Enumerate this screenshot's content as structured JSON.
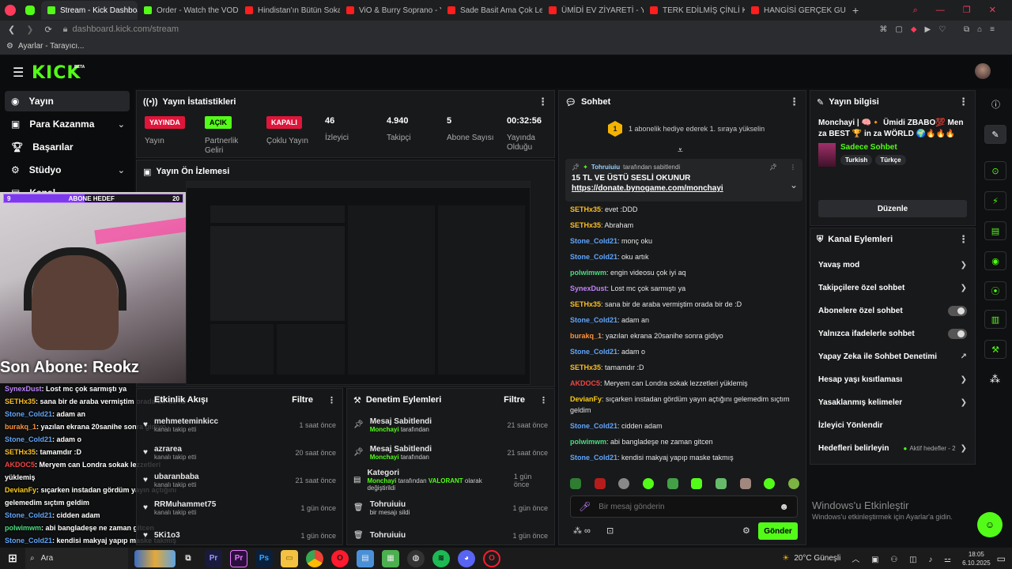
{
  "browser": {
    "tabs": [
      {
        "label": "Stream - Kick Dashboard",
        "kind": "kick",
        "active": true
      },
      {
        "label": "Order - Watch the VOD o",
        "kind": "kick"
      },
      {
        "label": "Hindistan'ın Bütün Sokak",
        "kind": "yt"
      },
      {
        "label": "ViO & Burry Soprano - Yo",
        "kind": "yt"
      },
      {
        "label": "Sade Basit Ama Çok Lezz",
        "kind": "yt"
      },
      {
        "label": "ÜMİDİ EV ZİYARETİ - You",
        "kind": "yt"
      },
      {
        "label": "TERK EDİLMİŞ ÇİNLİ KÖY",
        "kind": "yt"
      },
      {
        "label": "HANGİSİ GERÇEK GURBE",
        "kind": "yt"
      }
    ],
    "url": "dashboard.kick.com/stream",
    "bookmark": "Ayarlar - Tarayıcı..."
  },
  "kick": {
    "logo": "KICK",
    "logo_sup": "BETA"
  },
  "sidebar": {
    "items": [
      {
        "label": "Yayın",
        "active": true,
        "icon": "broadcast-icon",
        "chev": false
      },
      {
        "label": "Para Kazanma",
        "icon": "money-icon",
        "chev": true
      },
      {
        "label": "Başarılar",
        "icon": "trophy-icon",
        "chev": false
      },
      {
        "label": "Stüdyo",
        "icon": "studio-icon",
        "chev": true
      },
      {
        "label": "Kanal",
        "icon": "channel-icon",
        "chev": true
      }
    ]
  },
  "stats": {
    "title": "Yayın İstatistikleri",
    "items": [
      {
        "badge": "YAYINDA",
        "badge_color": "#e0153a",
        "label": "Yayın"
      },
      {
        "badge": "AÇIK",
        "badge_color": "#53fc18",
        "label": "Partnerlik Geliri"
      },
      {
        "badge": "KAPALI",
        "badge_color": "#e0153a",
        "label": "Çoklu Yayın"
      },
      {
        "value": "46",
        "label": "İzleyici"
      },
      {
        "value": "4.940",
        "label": "Takipçi"
      },
      {
        "value": "5",
        "label": "Abone Sayısı"
      },
      {
        "value": "00:32:56",
        "label": "Yayında Olduğu"
      }
    ]
  },
  "preview": {
    "title": "Yayın Ön İzlemesi"
  },
  "overlay": {
    "goal_count": "9",
    "goal_label": "ABONE HEDEF",
    "goal_max": "20",
    "last_sub": "Son Abone: Reokz",
    "chat": [
      {
        "u": "SynexDust",
        "c": "#c084fc",
        "m": "Lost mc çok sarmıştı ya"
      },
      {
        "u": "SETHx35",
        "c": "#fbbf24",
        "m": "sana bir de araba vermiştim orada bir de :D"
      },
      {
        "u": "Stone_Cold21",
        "c": "#60a5fa",
        "m": "adam an"
      },
      {
        "u": "burakq_1",
        "c": "#fb923c",
        "m": "yazılan ekrana 20sanihe sonra gidiyo"
      },
      {
        "u": "Stone_Cold21",
        "c": "#60a5fa",
        "m": "adam o"
      },
      {
        "u": "SETHx35",
        "c": "#fbbf24",
        "m": "tamamdır :D"
      },
      {
        "u": "AKDOC5",
        "c": "#ef4444",
        "m": "Meryem can Londra sokak lezzetleri yüklemiş"
      },
      {
        "u": "DevianFy",
        "c": "#facc15",
        "m": "sıçarken instadan gördüm yayın açtığını gelemedim sıçtım geldim"
      },
      {
        "u": "Stone_Cold21",
        "c": "#60a5fa",
        "m": "cidden adam"
      },
      {
        "u": "polwimwm",
        "c": "#4ade80",
        "m": "abi bangladeşe ne zaman gitcen"
      },
      {
        "u": "Stone_Cold21",
        "c": "#60a5fa",
        "m": "kendisi makyaj yapıp maske takmış"
      }
    ]
  },
  "activity": {
    "title": "Etkinlik Akışı",
    "filter": "Filtre",
    "rows": [
      {
        "name": "mehmeteminkicc",
        "sub": "kanalı takip etti",
        "time": "1 saat önce"
      },
      {
        "name": "azrarea",
        "sub": "kanalı takip etti",
        "time": "20 saat önce"
      },
      {
        "name": "ubaranbaba",
        "sub": "kanalı takip etti",
        "time": "21 saat önce"
      },
      {
        "name": "RRMuhammet75",
        "sub": "kanalı takip etti",
        "time": "1 gün önce"
      },
      {
        "name": "5Ki1o3",
        "sub": "",
        "time": "1 gün önce"
      }
    ]
  },
  "moderation": {
    "title": "Denetim Eylemleri",
    "filter": "Filtre",
    "rows": [
      {
        "title": "Mesaj Sabitlendi",
        "by": "Monchayi",
        "sub": " tarafından",
        "time": "21 saat önce"
      },
      {
        "title": "Mesaj Sabitlendi",
        "by": "Monchayi",
        "sub": " tarafından",
        "time": "21 saat önce"
      },
      {
        "title": "Kategori",
        "by": "Monchayi",
        "sub": " tarafından ",
        "extra": "VALORANT",
        "sub2": " olarak değiştirildi",
        "time": "1 gün önce"
      },
      {
        "title": "Tohruiuiu",
        "by": "",
        "sub": "bir mesajı sildi",
        "time": "1 gün önce"
      },
      {
        "title": "Tohruiuiu",
        "by": "",
        "sub": "",
        "time": "1 gün önce"
      }
    ]
  },
  "chat": {
    "title": "Sohbet",
    "gift_text": "1 abonelik hediye ederek 1. sıraya yükselin",
    "gift_rank": "1",
    "pinned_by": "Tohruiuiu",
    "pinned_by_suffix": " tarafından sabitlendi",
    "pinned_msg": "15 TL VE ÜSTÜ SESLİ OKUNUR",
    "pinned_link": "https://donate.bynogame.com/monchayi",
    "messages": [
      {
        "u": "SETHx35",
        "c": "#fbbf24",
        "m": "evet :DDD"
      },
      {
        "u": "SETHx35",
        "c": "#fbbf24",
        "m": "Abraham"
      },
      {
        "u": "Stone_Cold21",
        "c": "#60a5fa",
        "m": "monç oku"
      },
      {
        "u": "Stone_Cold21",
        "c": "#60a5fa",
        "m": "oku artık"
      },
      {
        "u": "polwimwm",
        "c": "#4ade80",
        "m": "engin videosu çok iyi aq"
      },
      {
        "u": "SynexDust",
        "c": "#c084fc",
        "m": "Lost mc çok sarmıştı ya"
      },
      {
        "u": "SETHx35",
        "c": "#fbbf24",
        "m": "sana bir de araba vermiştim orada bir de :D"
      },
      {
        "u": "Stone_Cold21",
        "c": "#60a5fa",
        "m": "adam an"
      },
      {
        "u": "burakq_1",
        "c": "#fb923c",
        "m": "yazılan ekrana 20sanihe sonra gidiyo"
      },
      {
        "u": "Stone_Cold21",
        "c": "#60a5fa",
        "m": "adam o"
      },
      {
        "u": "SETHx35",
        "c": "#fbbf24",
        "m": "tamamdır :D"
      },
      {
        "u": "AKDOC5",
        "c": "#ef4444",
        "m": "Meryem can Londra sokak lezzetleri yüklemiş"
      },
      {
        "u": "DevianFy",
        "c": "#facc15",
        "m": "sıçarken instadan gördüm yayın açtığını gelemedim sıçtım geldim"
      },
      {
        "u": "Stone_Cold21",
        "c": "#60a5fa",
        "m": "cidden adam"
      },
      {
        "u": "polwimwm",
        "c": "#4ade80",
        "m": "abi bangladeşe ne zaman gitcen"
      },
      {
        "u": "Stone_Cold21",
        "c": "#60a5fa",
        "m": "kendisi makyaj yapıp maske takmış"
      }
    ],
    "input_placeholder": "Bir mesaj gönderin",
    "send": "Gönder"
  },
  "info": {
    "title": "Yayın bilgisi",
    "stream_title": "Monchayi | 🧠🔸 Ümidi ZBABO💯 Men za BEST 🏆 in za WÖRLD 🌍🔥🔥🔥",
    "category": "Sadece Sohbet",
    "tags": [
      "Turkish",
      "Türkçe"
    ],
    "edit": "Düzenle"
  },
  "channel_actions": {
    "title": "Kanal Eylemleri",
    "rows": [
      {
        "label": "Yavaş mod",
        "type": "chev"
      },
      {
        "label": "Takipçilere özel sohbet",
        "type": "chev"
      },
      {
        "label": "Abonelere özel sohbet",
        "type": "toggle"
      },
      {
        "label": "Yalnızca ifadelerle sohbet",
        "type": "toggle"
      },
      {
        "label": "Yapay Zeka ile Sohbet Denetimi",
        "type": "ext"
      },
      {
        "label": "Hesap yaşı kısıtlaması",
        "type": "chev"
      },
      {
        "label": "Yasaklanmış kelimeler",
        "type": "chev"
      },
      {
        "label": "İzleyici Yönlendir",
        "type": "none"
      },
      {
        "label": "Hedefleri belirleyin",
        "type": "goal",
        "extra": "Aktif hedefler - 2"
      }
    ]
  },
  "watermark": {
    "line1": "Windows'u Etkinleştir",
    "line2": "Windows'u etkinleştirmek için Ayarlar'a gidin."
  },
  "taskbar": {
    "search": "Ara",
    "weather": "20°C  Güneşli",
    "time": "18:05",
    "date": "6.10.2025"
  }
}
